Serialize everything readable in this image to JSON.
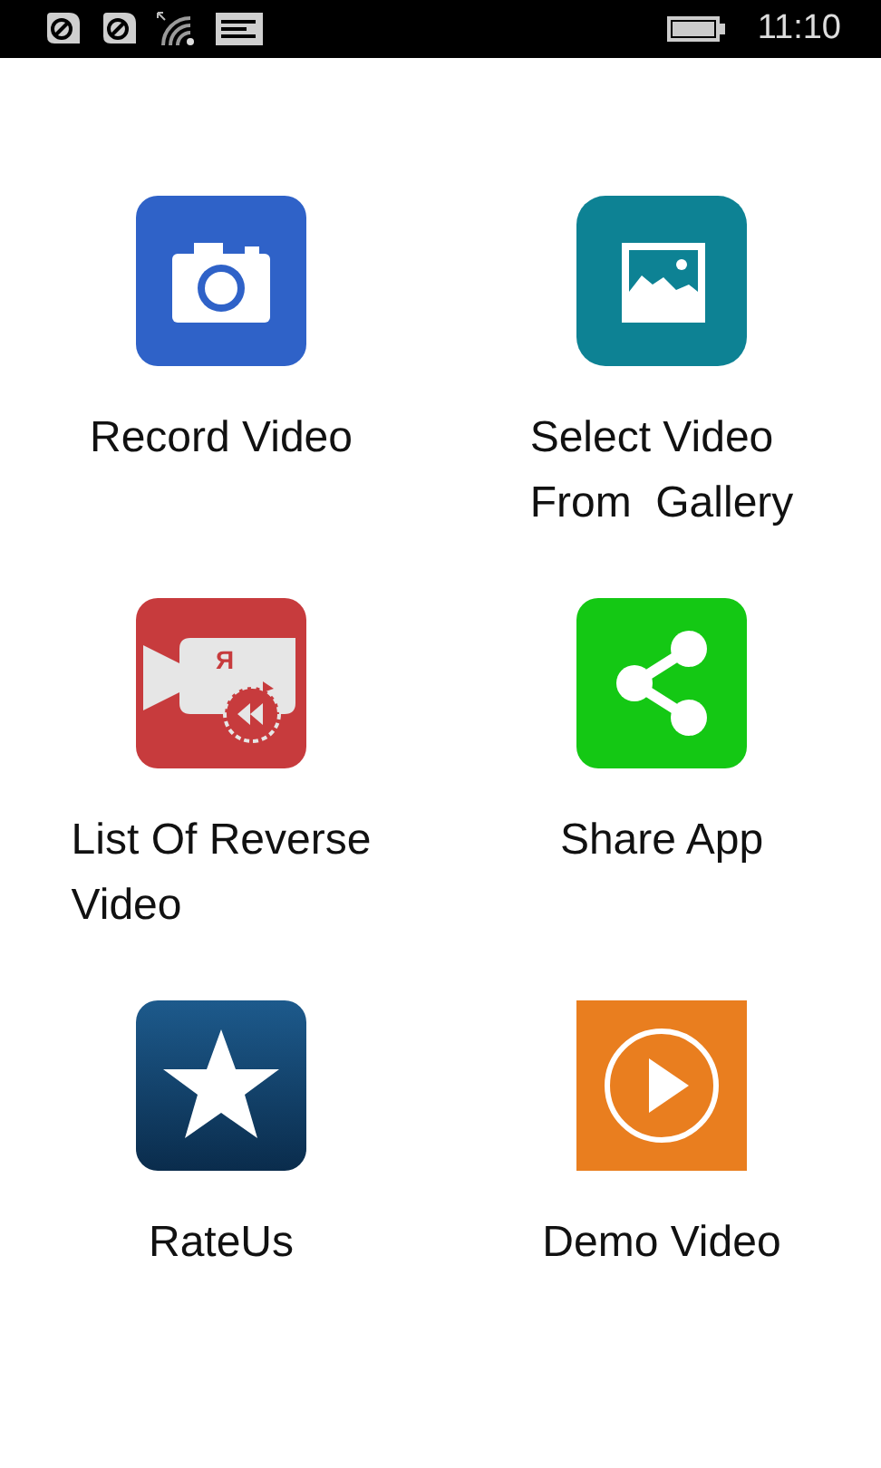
{
  "status_bar": {
    "time": "11:10"
  },
  "tiles": [
    {
      "kind": "camera",
      "label": "Record Video"
    },
    {
      "kind": "gallery",
      "label": "Select Video\nFrom  Gallery"
    },
    {
      "kind": "reverse",
      "label": "List Of Reverse\nVideo",
      "icon_letter": "Я"
    },
    {
      "kind": "share",
      "label": "Share App"
    },
    {
      "kind": "star",
      "label": "RateUs"
    },
    {
      "kind": "play",
      "label": "Demo Video"
    }
  ]
}
